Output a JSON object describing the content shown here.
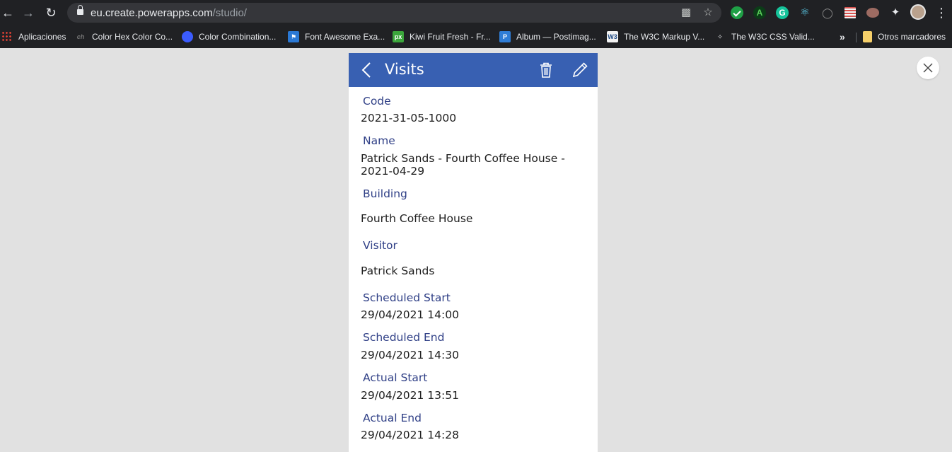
{
  "browser": {
    "url_host": "eu.create.powerapps.com",
    "url_path": "/studio/",
    "bookmarks": [
      {
        "label": "Aplicaciones",
        "icon": "apps-grid-icon"
      },
      {
        "label": "Color Hex Color Co...",
        "icon": "colorhex-icon"
      },
      {
        "label": "Color Combination...",
        "icon": "colorcombination-icon"
      },
      {
        "label": "Font Awesome Exa...",
        "icon": "flag-icon"
      },
      {
        "label": "Kiwi Fruit Fresh - Fr...",
        "icon": "pixabay-icon"
      },
      {
        "label": "Album — Postimag...",
        "icon": "postimage-icon"
      },
      {
        "label": "The W3C Markup V...",
        "icon": "w3c-icon"
      },
      {
        "label": "The W3C CSS Valid...",
        "icon": "css-validator-icon"
      }
    ],
    "other_bookmarks": "Otros marcadores",
    "bookmark_fav_text": {
      "ch": "ch",
      "px": "px",
      "pi": "P",
      "w3": "W3"
    }
  },
  "app": {
    "title": "Visits",
    "fields": [
      {
        "label": "Code",
        "value": "2021-31-05-1000"
      },
      {
        "label": "Name",
        "value": "Patrick Sands - Fourth Coffee House - 2021-04-29"
      },
      {
        "label": "Building",
        "value": "Fourth Coffee House"
      },
      {
        "label": "Visitor",
        "value": "Patrick Sands"
      },
      {
        "label": "Scheduled Start",
        "value": "29/04/2021 14:00"
      },
      {
        "label": "Scheduled End",
        "value": "29/04/2021 14:30"
      },
      {
        "label": "Actual Start",
        "value": "29/04/2021 13:51"
      },
      {
        "label": "Actual End",
        "value": "29/04/2021 14:28"
      }
    ]
  },
  "colors": {
    "header_blue": "#3860b2",
    "label_blue": "#2f3f86",
    "canvas_gray": "#e1e1e1"
  }
}
